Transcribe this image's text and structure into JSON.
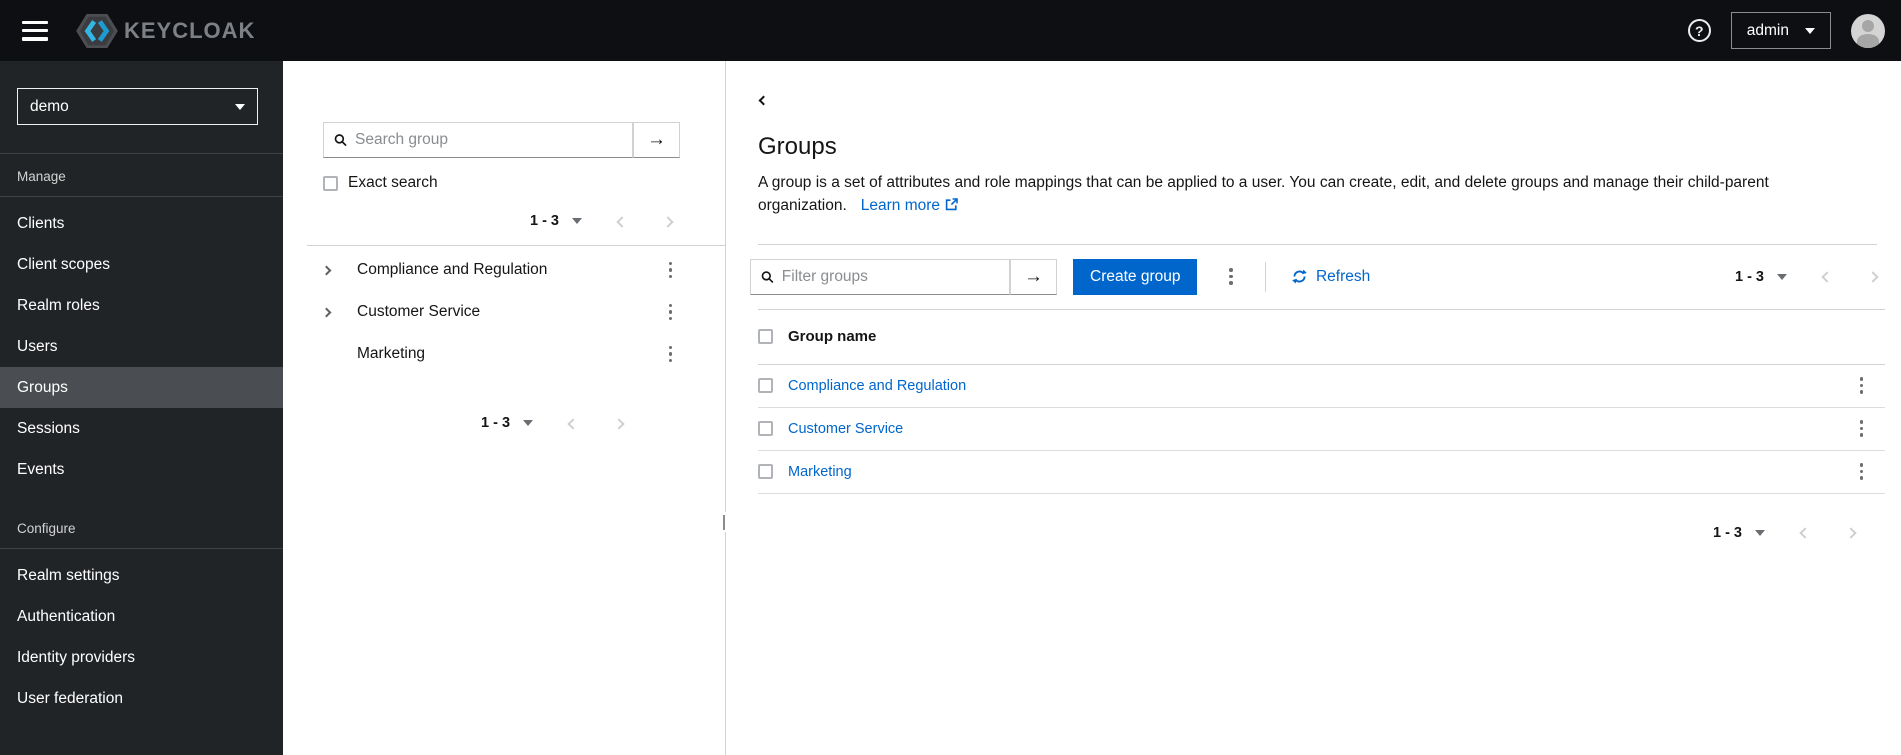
{
  "masthead": {
    "brand_text": "KEYCLOAK",
    "user_menu": "admin"
  },
  "sidebar": {
    "realm": "demo",
    "manage_label": "Manage",
    "manage_items": [
      "Clients",
      "Client scopes",
      "Realm roles",
      "Users",
      "Groups",
      "Sessions",
      "Events"
    ],
    "configure_label": "Configure",
    "configure_items": [
      "Realm settings",
      "Authentication",
      "Identity providers",
      "User federation"
    ],
    "selected_item": "Groups"
  },
  "tree_panel": {
    "search_placeholder": "Search group",
    "exact_search_label": "Exact search",
    "top_pagination": {
      "range": "1 - 3"
    },
    "items": [
      {
        "label": "Compliance and Regulation",
        "expandable": true
      },
      {
        "label": "Customer Service",
        "expandable": true
      },
      {
        "label": "Marketing",
        "expandable": false
      }
    ],
    "bottom_pagination": {
      "range": "1 - 3"
    }
  },
  "main": {
    "title": "Groups",
    "description": "A group is a set of attributes and role mappings that can be applied to a user. You can create, edit, and delete groups and manage their child-parent organization.",
    "learn_more_label": "Learn more",
    "toolbar": {
      "filter_placeholder": "Filter groups",
      "create_button": "Create group",
      "refresh_label": "Refresh",
      "pagination": {
        "range": "1 - 3"
      }
    },
    "table": {
      "header": "Group name",
      "rows": [
        {
          "name": "Compliance and Regulation"
        },
        {
          "name": "Customer Service"
        },
        {
          "name": "Marketing"
        }
      ]
    },
    "bottom_pagination": {
      "range": "1 - 3"
    }
  },
  "icons": {
    "arrow_right_glyph": "→",
    "help_glyph": "?"
  },
  "colors": {
    "primary_blue": "#0066cc",
    "link_blue": "#0066cc",
    "masthead_bg": "#0d0f12",
    "sidebar_bg": "#212427",
    "sidebar_selected_bg": "#4a4e52",
    "logo_cyan": "#33b6e4"
  }
}
